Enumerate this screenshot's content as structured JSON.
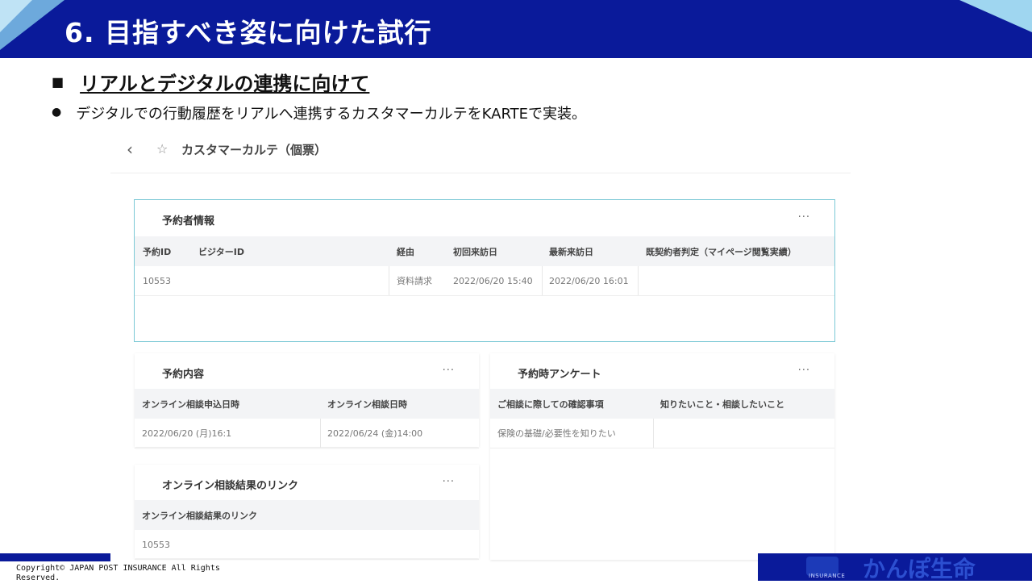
{
  "slide": {
    "title": "6. 目指すべき姿に向けた試行",
    "section_bullet": "■",
    "section_title": "リアルとデジタルの連携に向けて",
    "bullet": "●",
    "bullet_text": "デジタルでの行動履歴をリアルへ連携するカスタマーカルテをKARTEで実装。"
  },
  "screenshot": {
    "back_icon": "‹",
    "star_icon": "☆",
    "title": "カスタマーカルテ（個票）",
    "menu_glyph": "···",
    "cards": {
      "reservation_info": {
        "title": "予約者情報",
        "headers": [
          "予約ID",
          "ビジターID",
          "経由",
          "初回来訪日",
          "最新来訪日",
          "既契約者判定（マイページ閲覧実績）"
        ],
        "row": [
          "10553",
          "",
          "資料請求",
          "2022/06/20 15:40",
          "2022/06/20 16:01",
          ""
        ]
      },
      "reservation_details": {
        "title": "予約内容",
        "headers": [
          "オンライン相談申込日時",
          "オンライン相談日時"
        ],
        "row": [
          "2022/06/20 (月)16:1",
          "2022/06/24 (金)14:00"
        ]
      },
      "survey": {
        "title": "予約時アンケート",
        "headers": [
          "ご相談に際しての確認事項",
          "知りたいこと・相談したいこと"
        ],
        "row": [
          "保険の基礎/必要性を知りたい",
          ""
        ]
      },
      "result_link": {
        "title": "オンライン相談結果のリンク",
        "headers": [
          "オンライン相談結果のリンク"
        ],
        "row": [
          "10553"
        ]
      }
    }
  },
  "footer": {
    "copyright": "Copyright© JAPAN POST INSURANCE All Rights Reserved.",
    "logo_text": "かんぽ生命",
    "logo_sub": "INSURANCE"
  },
  "colors": {
    "brand_navy": "#0a1a9a",
    "accent_light_blue": "#7fc3e8",
    "selected_border": "#7cc9d6"
  }
}
